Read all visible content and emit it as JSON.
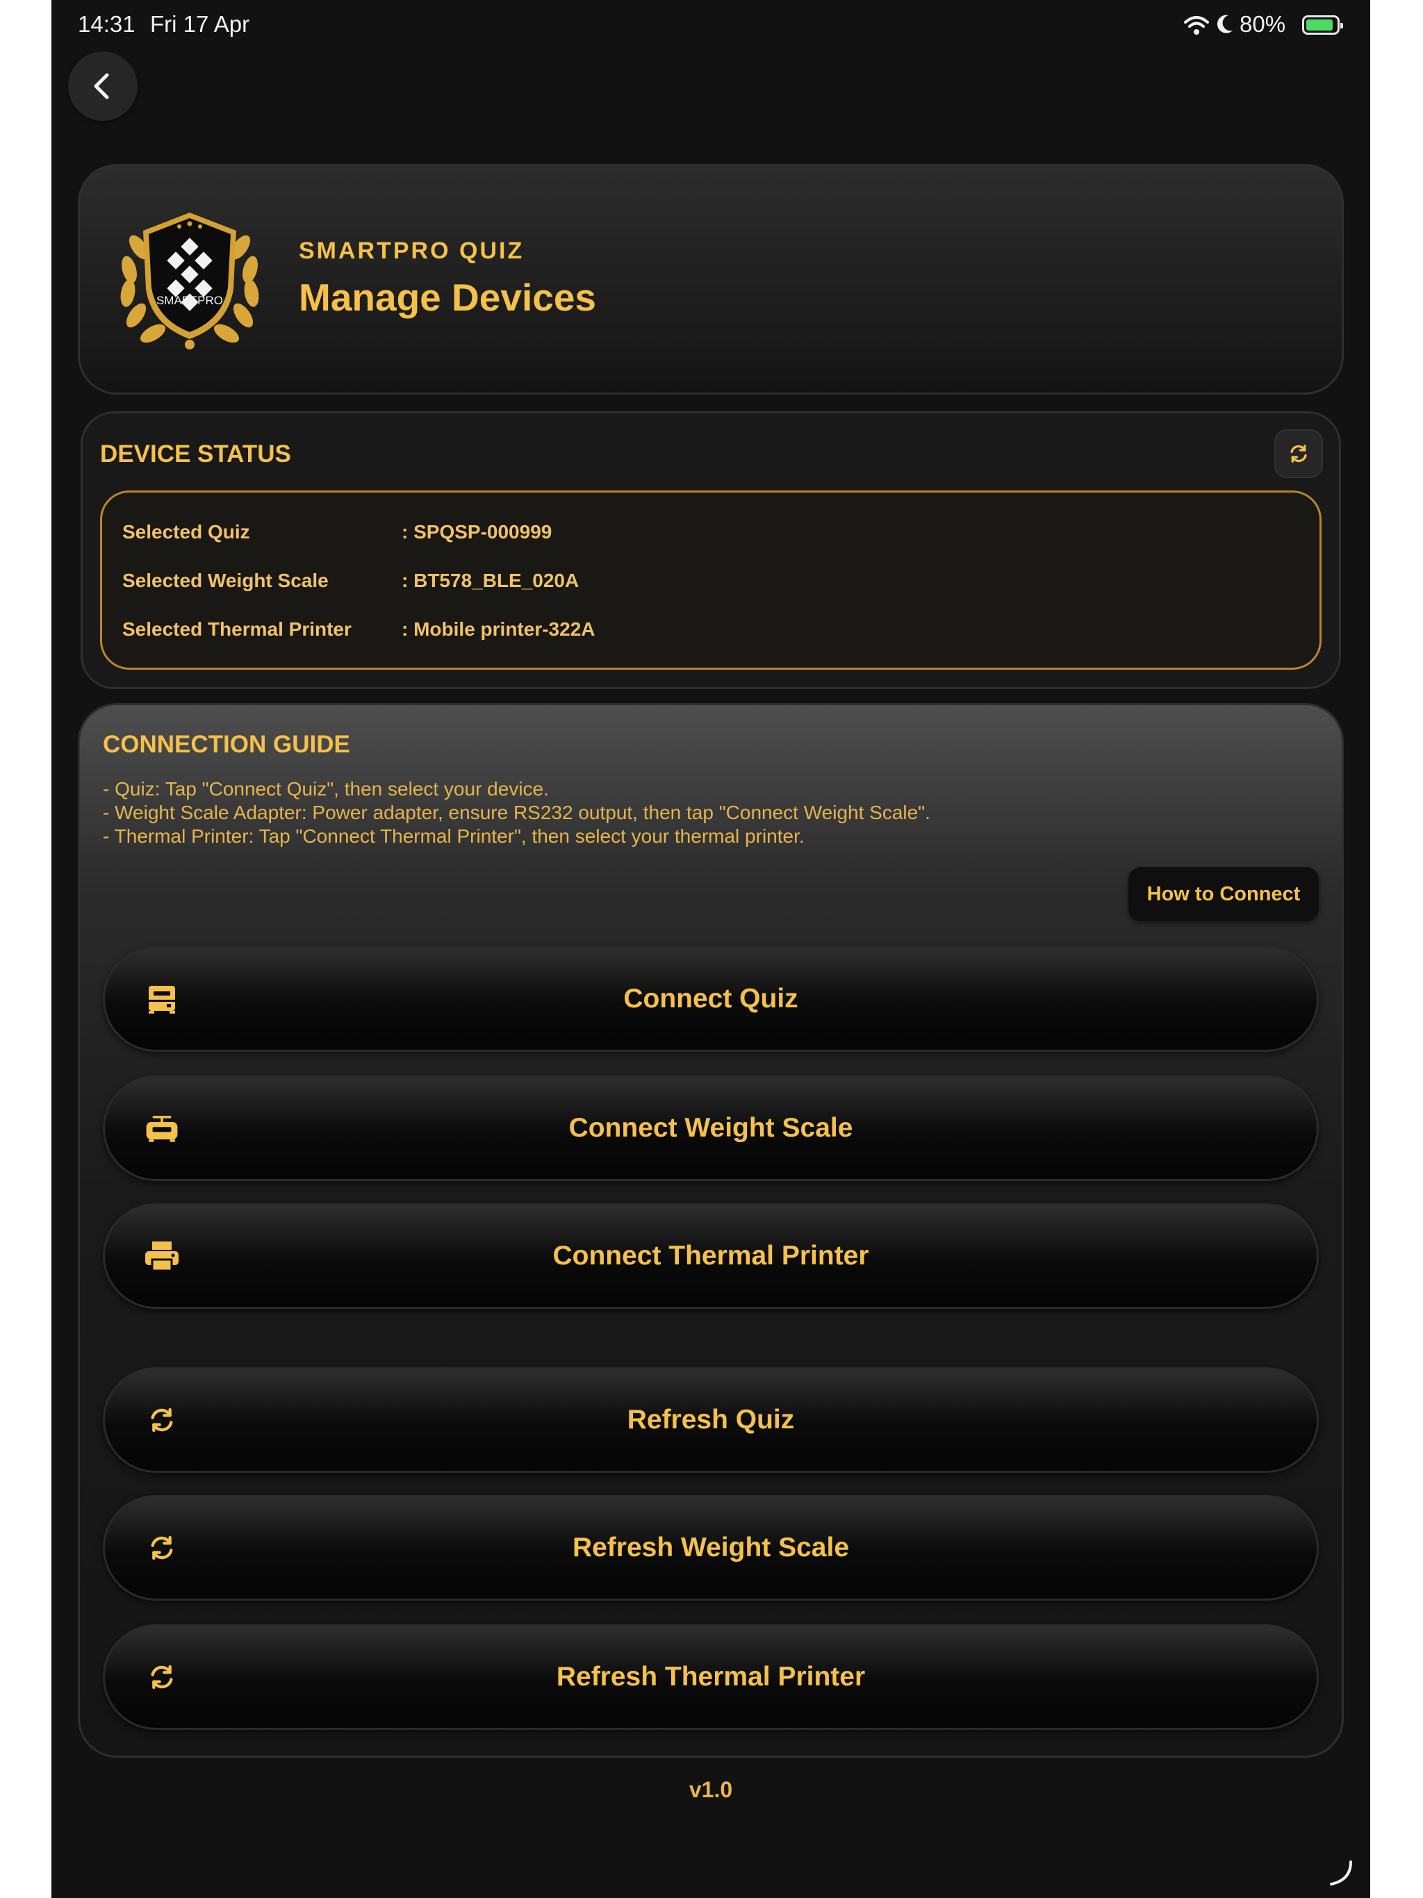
{
  "status_bar": {
    "time": "14:31",
    "date": "Fri 17 Apr",
    "battery": "80%",
    "battery_level": 0.8
  },
  "header": {
    "logo_text": "SMARTPRO",
    "brand": "SMARTPRO QUIZ",
    "title": "Manage Devices"
  },
  "device_status": {
    "title": "DEVICE STATUS",
    "rows": [
      {
        "label": "Selected Quiz",
        "value": ": SPQSP-000999"
      },
      {
        "label": "Selected Weight Scale",
        "value": ": BT578_BLE_020A"
      },
      {
        "label": "Selected Thermal Printer",
        "value": ": Mobile printer-322A"
      }
    ]
  },
  "guide": {
    "title": "CONNECTION GUIDE",
    "lines": [
      "- Quiz: Tap \"Connect Quiz\", then select your device.",
      "- Weight Scale Adapter: Power adapter, ensure RS232 output, then tap \"Connect Weight Scale\".",
      "- Thermal Printer: Tap \"Connect Thermal Printer\", then select your thermal printer."
    ],
    "how_to": "How to Connect"
  },
  "actions": [
    {
      "label": "Connect Quiz",
      "icon": "device-icon"
    },
    {
      "label": "Connect Weight Scale",
      "icon": "scale-icon"
    },
    {
      "label": "Connect Thermal Printer",
      "icon": "printer-icon"
    },
    {
      "label": "Refresh Quiz",
      "icon": "refresh-icon"
    },
    {
      "label": "Refresh Weight Scale",
      "icon": "refresh-icon"
    },
    {
      "label": "Refresh Thermal Printer",
      "icon": "refresh-icon"
    }
  ],
  "version": "v1.0",
  "colors": {
    "accent": "#f5c14a",
    "background": "#121212",
    "border_gold": "#b8862a"
  }
}
